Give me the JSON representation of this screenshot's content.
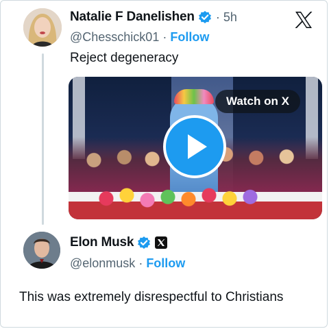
{
  "tweet1": {
    "display_name": "Natalie F Danelishen",
    "time": "· 5h",
    "handle": "@Chesschick01",
    "separator": " · ",
    "follow": "Follow",
    "text": "Reject degeneracy",
    "media": {
      "watch_label": "Watch on X",
      "play_icon": "play-icon"
    },
    "verified_icon": "verified-badge-icon"
  },
  "tweet2": {
    "display_name": "Elon Musk",
    "handle": "@elonmusk",
    "separator": " · ",
    "follow": "Follow",
    "text": "This was extremely disrespectful to Christians",
    "verified_icon": "verified-badge-icon",
    "affiliate_icon": "x-affiliate-badge-icon"
  },
  "brand": {
    "logo_icon": "x-logo-icon"
  },
  "colors": {
    "accent": "#1d9bf0",
    "text": "#0f1419",
    "muted": "#536471",
    "border": "#cfd9de"
  }
}
